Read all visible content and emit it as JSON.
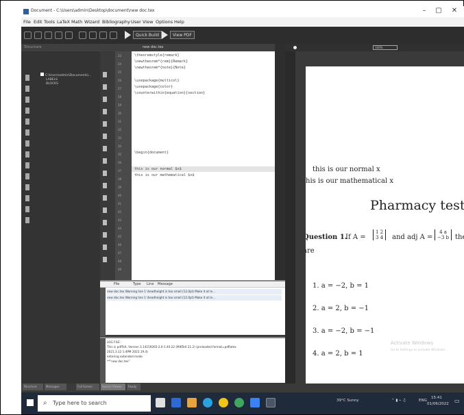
{
  "window": {
    "title": "Document - C:\\Users\\admin\\Desktop\\document\\new doc.tex",
    "minimize": "–",
    "maximize": "▢",
    "close": "✕"
  },
  "menu": [
    "File",
    "Edit",
    "Tools",
    "LaTeX",
    "Math",
    "Wizard",
    "Bibliography",
    "User",
    "View",
    "Options",
    "Help"
  ],
  "toolbar": {
    "quick_build": "Quick Build",
    "view_pdf": "View PDF"
  },
  "structure": {
    "header": "Structure",
    "tree": [
      "C:\\Users\\admin\\Documents\\...",
      "LABELS",
      "BLOCKS"
    ]
  },
  "editor": {
    "tab": "new doc.tex",
    "line_numbers": [
      "23",
      "24",
      "25",
      "26",
      "27",
      "28",
      "29",
      "30",
      "31",
      "32",
      "33",
      "34",
      "35",
      "36",
      "37",
      "38",
      "39",
      "40",
      "41",
      "42",
      "43",
      "44",
      "45",
      "46",
      "47",
      "48",
      "49"
    ],
    "lines": [
      "\\theoremstyle{remark}",
      "\\newtheorem*{rem}{Remark}",
      "\\newtheorem*{note}{Note}",
      "",
      "\\usepackage{multicol}",
      "\\usepackage{color}",
      "\\counterwithin{equation}{section}",
      "",
      "",
      "",
      "\\begin{document}",
      "",
      "this is our normal $x$",
      "this is our mathematical $x$"
    ]
  },
  "messages": {
    "columns": [
      "File",
      "Type",
      "Line",
      "Message"
    ],
    "rows": [
      "new doc.tex  Warning  line 1  \\headheight is too small (12.0pt) Make it at le...",
      "new doc.tex  Warning  line 1  \\headheight is too small (12.0pt) Make it at le..."
    ]
  },
  "log": {
    "lines": [
      "LOG FILE :",
      "This is pdfTeX, Version 3.14159265-2.6-1.40.22 (MiKTeX 21.2) (preloaded format=pdflatex",
      "2021.3.12  1:4PM  2022.19.4)",
      "entering extended mode",
      "**\"new doc.tex\""
    ]
  },
  "pdf": {
    "zoom": "100%",
    "line1": "this is our normal x",
    "line2": "this is our mathematical x",
    "heading": "Pharmacy test",
    "question_label": "Question 1.",
    "question_if": "If A =",
    "matrix_a": [
      "1  2",
      "3  4"
    ],
    "question_and": "and adj A =",
    "matrix_adj": [
      "4   a",
      "−3  b"
    ],
    "question_tail": "the",
    "question_are": "are",
    "options": [
      "1.  a = −2, b = 1",
      "2.  a = 2, b = −1",
      "3.  a = −2, b = −1",
      "4.  a = 2, b = 1"
    ],
    "watermark1": "Activate Windows",
    "watermark2": "Go to Settings to activate Windows."
  },
  "status": [
    "Structure",
    "Messages",
    "Full Screen",
    "Source Viewer",
    "Ready"
  ],
  "taskbar": {
    "search_placeholder": "Type here to search",
    "weather": "39°C Sunny",
    "time": "15:41",
    "date": "01/06/2022",
    "lang": "ENG"
  }
}
